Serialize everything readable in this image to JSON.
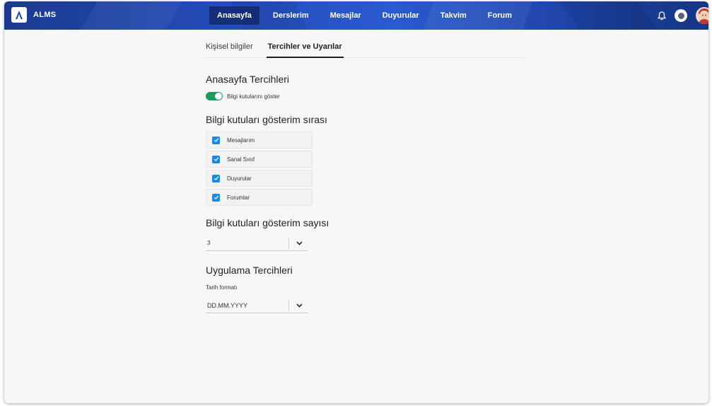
{
  "app": {
    "logo_text": "ALMS"
  },
  "nav": {
    "items": [
      {
        "label": "Anasayfa",
        "active": true
      },
      {
        "label": "Derslerim",
        "active": false
      },
      {
        "label": "Mesajlar",
        "active": false
      },
      {
        "label": "Duyurular",
        "active": false
      },
      {
        "label": "Takvim",
        "active": false
      },
      {
        "label": "Forum",
        "active": false
      }
    ],
    "icons": [
      "bell-icon",
      "theme-toggle-icon",
      "avatar"
    ]
  },
  "tabs": [
    {
      "label": "Kişisel bilgiler",
      "active": false
    },
    {
      "label": "Tercihler ve Uyarılar",
      "active": true
    }
  ],
  "home_prefs": {
    "title": "Anasayfa Tercihleri",
    "toggle_label": "Bilgi kutularını göster",
    "toggle_on": true
  },
  "order": {
    "title": "Bilgi kutuları gösterim sırası",
    "items": [
      {
        "label": "Mesajlarım",
        "checked": true
      },
      {
        "label": "Sanal Sınıf",
        "checked": true
      },
      {
        "label": "Duyurular",
        "checked": true
      },
      {
        "label": "Forumlar",
        "checked": true
      }
    ]
  },
  "count": {
    "title": "Bilgi kutuları gösterim sayısı",
    "value": "3"
  },
  "app_prefs": {
    "title": "Uygulama Tercihleri",
    "date_label": "Tarih formatı",
    "date_value": "DD.MM.YYYY"
  },
  "colors": {
    "topbar": "#234bb8",
    "toggle_on": "#1d9a5c",
    "checkbox": "#1a88e6"
  }
}
